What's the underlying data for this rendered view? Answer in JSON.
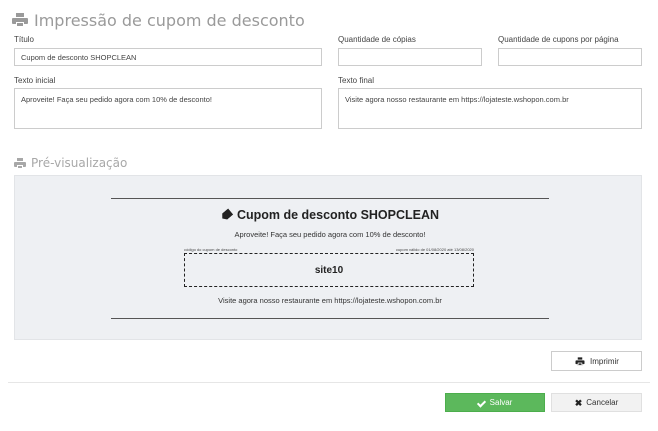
{
  "header": {
    "title": "Impressão de cupom de desconto"
  },
  "form": {
    "title_label": "Título",
    "title_value": "Cupom de desconto SHOPCLEAN",
    "copies_label": "Quantidade de cópias",
    "copies_value": "",
    "per_page_label": "Quantidade de cupons por página",
    "per_page_value": "",
    "initial_label": "Texto inicial",
    "initial_value": "Aproveite! Faça seu pedido agora com 10% de desconto!",
    "final_label": "Texto final",
    "final_value": "Visite agora nosso restaurante em https://lojateste.wshopon.com.br"
  },
  "preview": {
    "section_title": "Pré-visualização",
    "coupon_title": "Cupom de desconto SHOPCLEAN",
    "initial_text": "Aproveite! Faça seu pedido agora com 10% de desconto!",
    "code_label": "código do cupom de desconto",
    "validity": "cupom válido de 01/08/2020 até 13/08/2020",
    "code": "site10",
    "final_text": "Visite agora nosso restaurante em https://lojateste.wshopon.com.br"
  },
  "actions": {
    "print_label": "Imprimir",
    "save_label": "Salvar",
    "cancel_label": "Cancelar"
  },
  "colors": {
    "save": "#5cb85c",
    "preview_bg": "#eef0f3"
  }
}
